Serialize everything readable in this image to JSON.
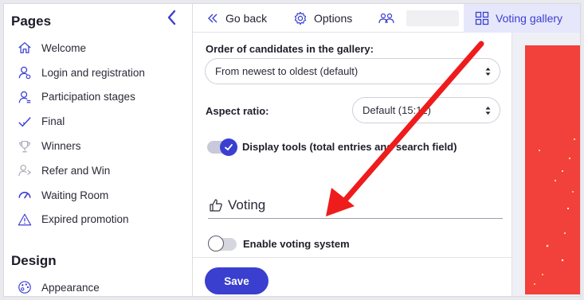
{
  "sidebar": {
    "pages_heading": "Pages",
    "items": [
      {
        "label": "Welcome",
        "icon": "home-icon"
      },
      {
        "label": "Login and registration",
        "icon": "user-icon"
      },
      {
        "label": "Participation stages",
        "icon": "user-stages-icon"
      },
      {
        "label": "Final",
        "icon": "check-icon"
      },
      {
        "label": "Winners",
        "icon": "trophy-icon"
      },
      {
        "label": "Refer and Win",
        "icon": "share-icon"
      },
      {
        "label": "Waiting Room",
        "icon": "gauge-icon"
      },
      {
        "label": "Expired promotion",
        "icon": "warning-icon"
      }
    ],
    "design_heading": "Design",
    "appearance_label": "Appearance"
  },
  "topbar": {
    "back_label": "Go back",
    "options_label": "Options",
    "gallery_label": "Voting gallery"
  },
  "form": {
    "order_label": "Order of candidates in the gallery:",
    "order_value": "From newest to oldest (default)",
    "aspect_label": "Aspect ratio:",
    "aspect_value": "Default (15:12)",
    "display_tools_label": "Display tools (total entries and search field)",
    "display_tools_on": true,
    "voting_title": "Voting",
    "enable_voting_label": "Enable voting system",
    "enable_voting_on": false,
    "save_label": "Save"
  },
  "colors": {
    "accent": "#3a3fcf",
    "annotation_arrow": "#ee1c1c",
    "preview_bg": "#f2403a"
  }
}
